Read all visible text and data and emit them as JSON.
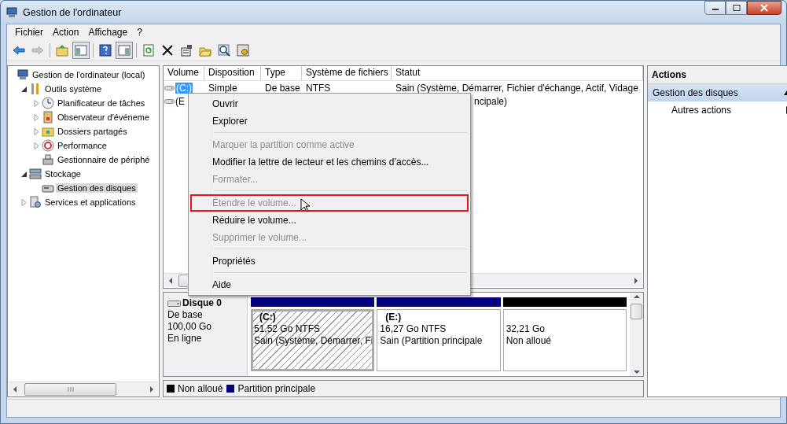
{
  "window": {
    "title": "Gestion de l'ordinateur"
  },
  "menu": [
    "Fichier",
    "Action",
    "Affichage",
    "?"
  ],
  "toolbar": [
    {
      "disabled": false,
      "pressed": false
    },
    {
      "disabled": true,
      "pressed": false
    },
    {
      "disabled": false,
      "pressed": false
    },
    {
      "disabled": false,
      "pressed": true
    },
    {
      "disabled": false,
      "pressed": false
    },
    {
      "disabled": false,
      "pressed": true
    },
    {
      "disabled": false,
      "pressed": false
    },
    {
      "disabled": false,
      "pressed": false
    },
    {
      "disabled": false,
      "pressed": false
    },
    {
      "disabled": false,
      "pressed": false
    },
    {
      "disabled": false,
      "pressed": false
    },
    {
      "disabled": false,
      "pressed": false
    }
  ],
  "tree": [
    {
      "label": "Gestion de l'ordinateur (local)",
      "selected": false,
      "children": [
        {
          "label": "Outils système",
          "expanded": true,
          "selected": false,
          "children": [
            {
              "label": "Planificateur de tâches",
              "expanded": false,
              "selected": false
            },
            {
              "label": "Observateur d'événeme",
              "expanded": false,
              "selected": false
            },
            {
              "label": "Dossiers partagés",
              "expanded": false,
              "selected": false
            },
            {
              "label": "Performance",
              "expanded": false,
              "selected": false
            },
            {
              "label": "Gestionnaire de périphé",
              "selected": false
            }
          ]
        },
        {
          "label": "Stockage",
          "expanded": true,
          "selected": false,
          "children": [
            {
              "label": "Gestion des disques",
              "selected": true
            }
          ]
        },
        {
          "label": "Services et applications",
          "expanded": false,
          "selected": false
        }
      ]
    }
  ],
  "volumes": {
    "columns": [
      "Volume",
      "Disposition",
      "Type",
      "Système de fichiers",
      "Statut"
    ],
    "rows": [
      {
        "volume": "(C:)",
        "disposition": "Simple",
        "type": "De base",
        "filesystem": "NTFS",
        "status": "Sain (Système, Démarrer, Fichier d'échange, Actif, Vidage",
        "selected": true
      },
      {
        "volume": "(E",
        "status": "ncipale)",
        "selected": false
      }
    ]
  },
  "context_menu": [
    {
      "kind": "item",
      "label": "Ouvrir",
      "disabled": false,
      "outlined": false
    },
    {
      "kind": "item",
      "label": "Explorer",
      "disabled": false,
      "outlined": false
    },
    {
      "kind": "separator"
    },
    {
      "kind": "item",
      "label": "Marquer la partition comme active",
      "disabled": true,
      "outlined": false
    },
    {
      "kind": "item",
      "label": "Modifier la lettre de lecteur et les chemins d’accès...",
      "disabled": false,
      "outlined": false
    },
    {
      "kind": "item",
      "label": "Formater...",
      "disabled": true,
      "outlined": false
    },
    {
      "kind": "separator"
    },
    {
      "kind": "item",
      "label": "Étendre le volume...",
      "disabled": true,
      "outlined": true
    },
    {
      "kind": "item",
      "label": "Réduire le volume...",
      "disabled": false,
      "outlined": false
    },
    {
      "kind": "item",
      "label": "Supprimer le volume...",
      "disabled": true,
      "outlined": false
    },
    {
      "kind": "separator"
    },
    {
      "kind": "item",
      "label": "Propriétés",
      "disabled": false,
      "outlined": false
    },
    {
      "kind": "separator"
    },
    {
      "kind": "item",
      "label": "Aide",
      "disabled": false,
      "outlined": false
    }
  ],
  "disk": {
    "name": "Disque 0",
    "type": "De base",
    "size": "100,00 Go",
    "status": "En ligne",
    "partitions": [
      {
        "label": "(C:)",
        "size": "51,52 Go NTFS",
        "status": "Sain (Système, Démarrer, Fi",
        "color": "#000080",
        "selected": true
      },
      {
        "label": "(E:)",
        "size": "16,27 Go NTFS",
        "status": "Sain (Partition principale",
        "color": "#000080",
        "selected": false
      },
      {
        "size": "32,21 Go",
        "status": "Non alloué",
        "color": "#000000",
        "selected": false
      }
    ]
  },
  "legend": [
    {
      "label": "Non alloué",
      "color": "#000000"
    },
    {
      "label": "Partition principale",
      "color": "#000080"
    }
  ],
  "actions": {
    "title": "Actions",
    "sections": [
      {
        "label": "Gestion des disques",
        "expanded": true,
        "items": [
          "Autres actions"
        ]
      }
    ]
  }
}
